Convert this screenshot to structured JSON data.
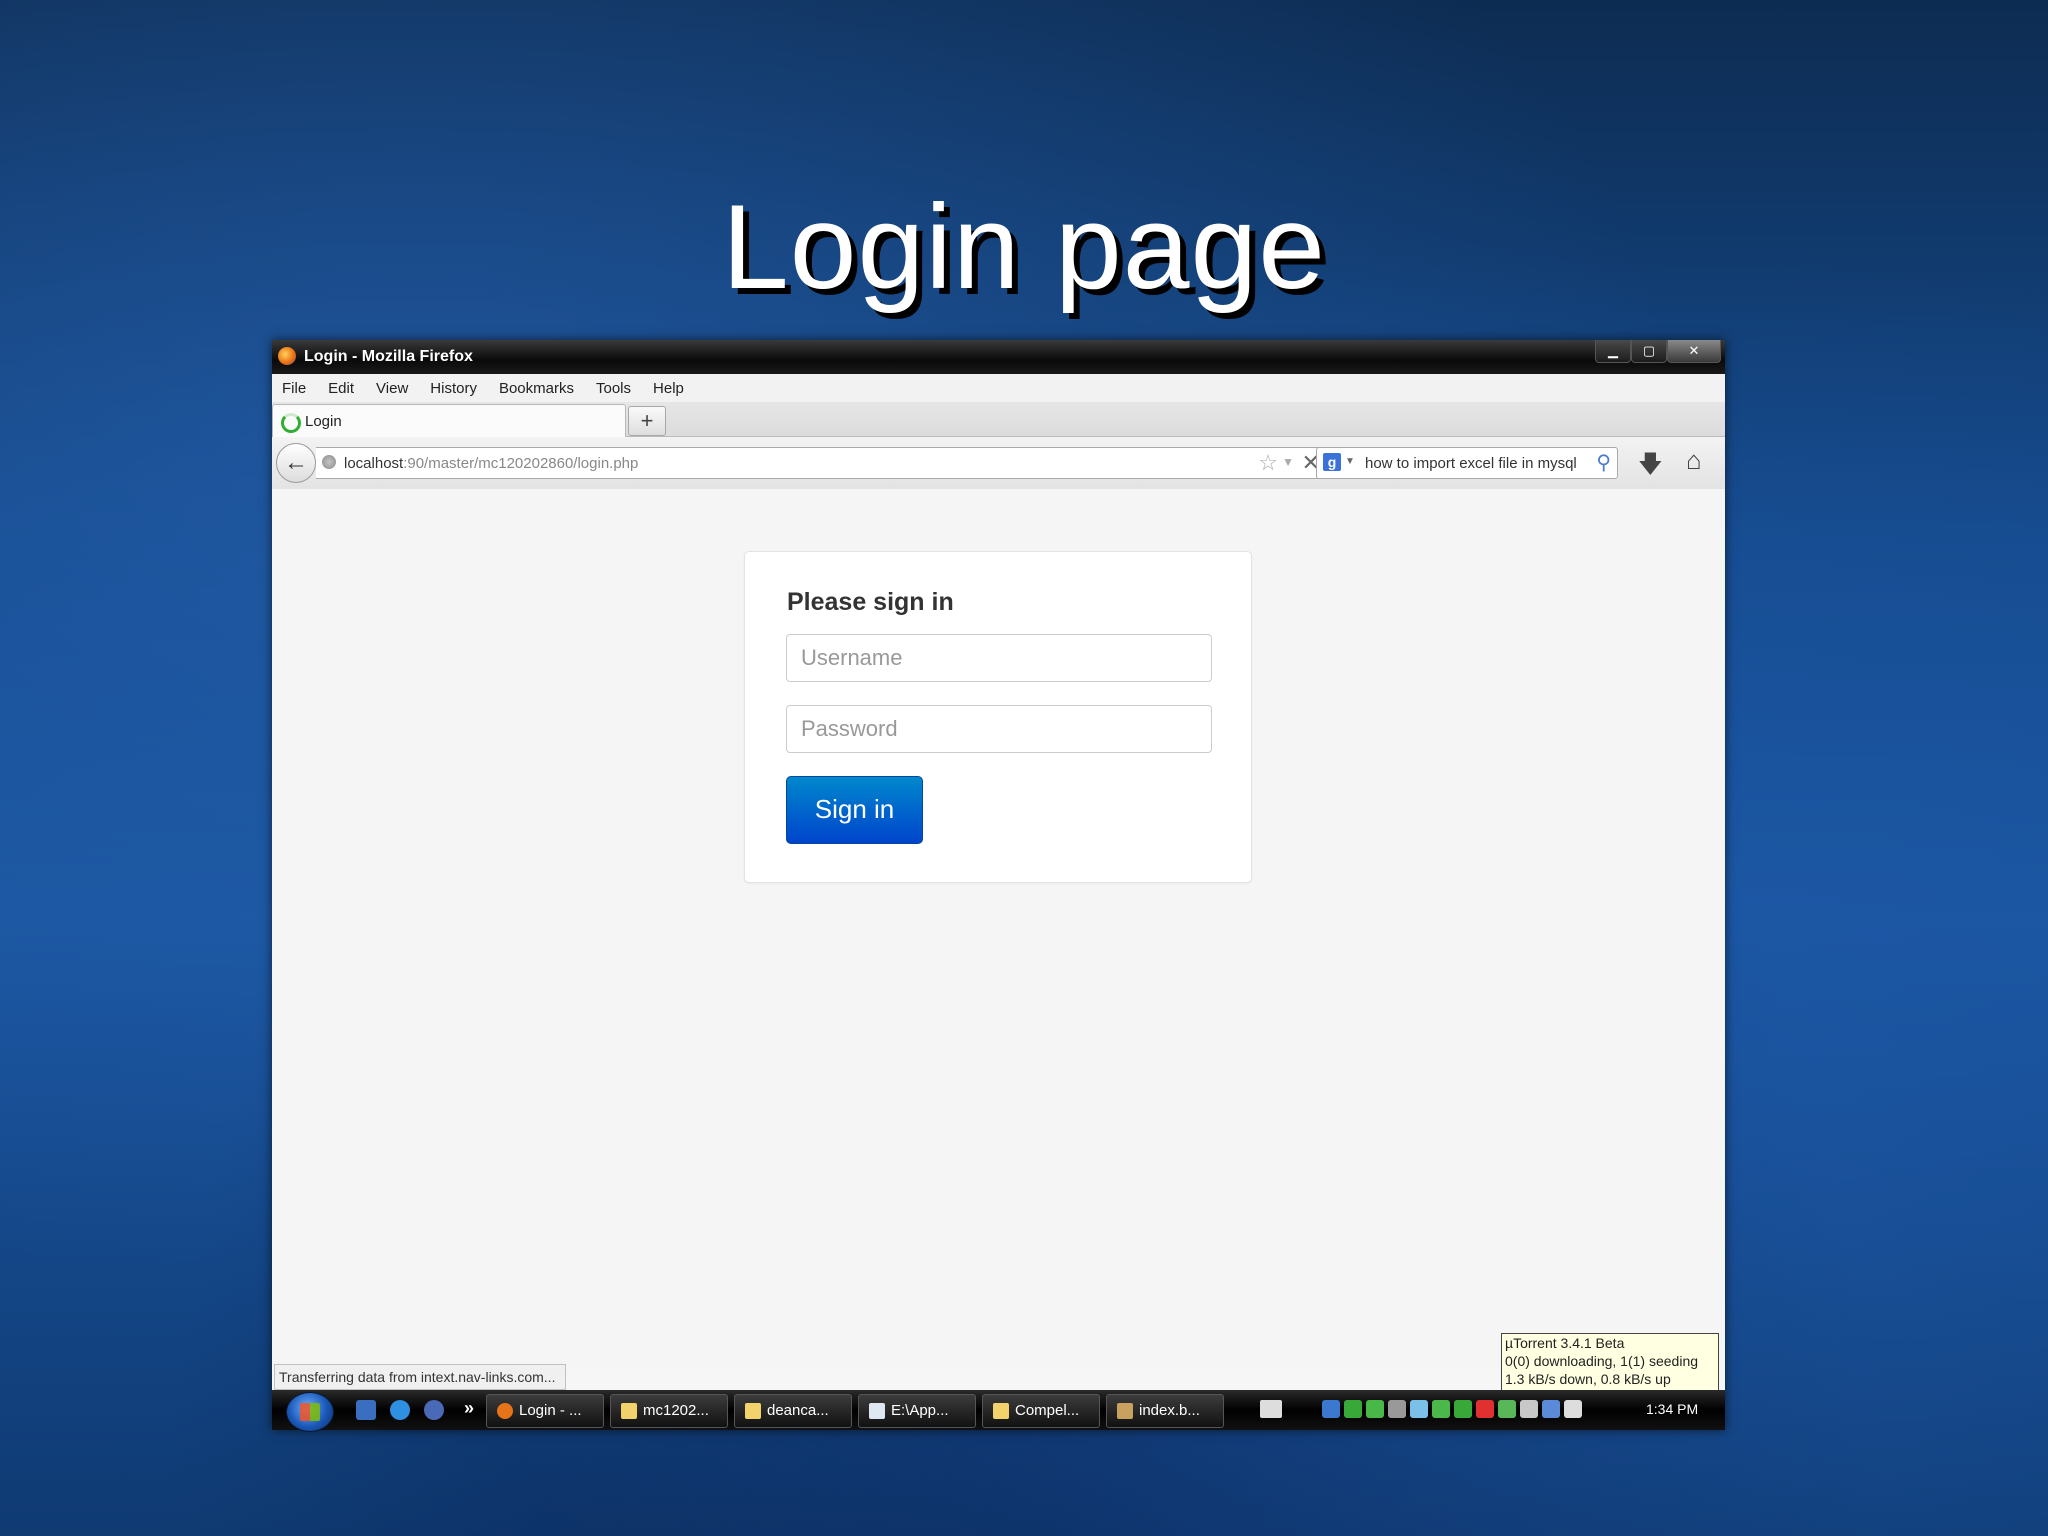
{
  "slide": {
    "title": "Login page"
  },
  "window": {
    "title": "Login - Mozilla Firefox",
    "minimize": "▁",
    "restore": "▢",
    "close": "✕"
  },
  "menu": {
    "items": [
      "File",
      "Edit",
      "View",
      "History",
      "Bookmarks",
      "Tools",
      "Help"
    ]
  },
  "tabs": {
    "active_label": "Login",
    "new_tab": "+"
  },
  "navbar": {
    "url_host": "localhost",
    "url_rest": ":90/master/mc120202860/login.php",
    "search_engine": "g",
    "search_text": "how to import excel file in mysql"
  },
  "login": {
    "heading": "Please sign in",
    "username_placeholder": "Username",
    "password_placeholder": "Password",
    "submit_label": "Sign in"
  },
  "status": {
    "text": "Transferring data from intext.nav-links.com..."
  },
  "utorrent": {
    "line1": "µTorrent 3.4.1 Beta",
    "line2": "0(0) downloading, 1(1) seeding",
    "line3": "1.3 kB/s down, 0.8 kB/s up"
  },
  "taskbar": {
    "buttons": [
      "Login - ...",
      "mc1202...",
      "deanca...",
      "E:\\App...",
      "Compel...",
      "index.b..."
    ],
    "clock": "1:34 PM"
  },
  "icons": {
    "back": "back-arrow-icon",
    "star": "bookmark-star-icon",
    "stop": "stop-icon",
    "search": "magnifier-icon",
    "download": "download-arrow-icon",
    "home": "home-icon"
  },
  "colors": {
    "primary_button": "#0044cc",
    "slide_title": "#ffffff"
  }
}
